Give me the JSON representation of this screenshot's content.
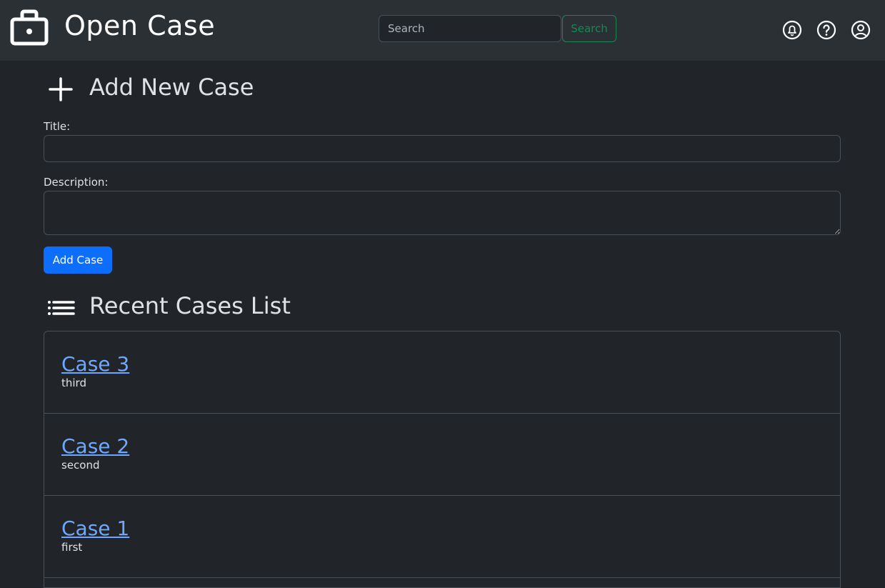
{
  "header": {
    "brand_icon": "briefcase-icon",
    "title": "Open Case",
    "search": {
      "placeholder": "Search",
      "value": "",
      "button_label": "Search"
    },
    "icons": [
      "bell-icon",
      "help-icon",
      "user-circle-icon"
    ]
  },
  "add_case": {
    "icon": "plus-icon",
    "heading": "Add New Case",
    "title_label": "Title:",
    "title_value": "",
    "description_label": "Description:",
    "description_value": "",
    "submit_label": "Add Case"
  },
  "recent": {
    "icon": "list-icon",
    "heading": "Recent Cases List",
    "cases": [
      {
        "title": "Case 3",
        "description": "third"
      },
      {
        "title": "Case 2",
        "description": "second"
      },
      {
        "title": "Case 1",
        "description": "first"
      }
    ]
  },
  "colors": {
    "background": "#212529",
    "topbar": "#2b3035",
    "primary": "#0d6efd",
    "success": "#198754",
    "link": "#6ea8fe",
    "border": "#495057"
  }
}
